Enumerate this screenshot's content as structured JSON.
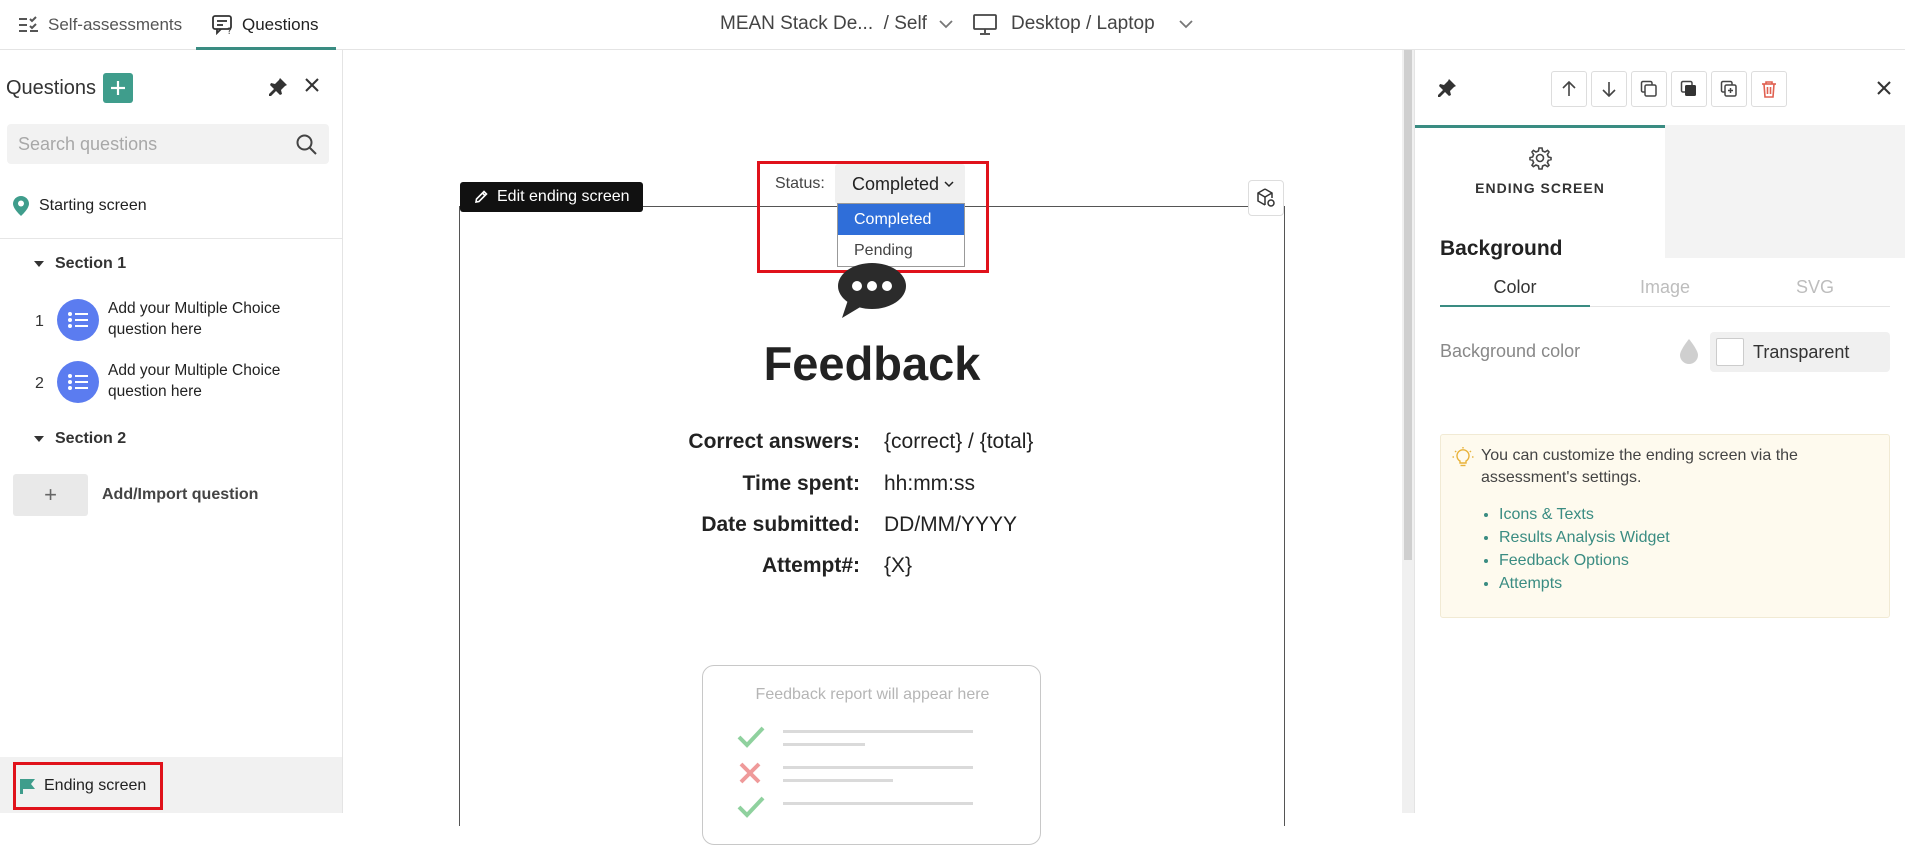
{
  "topbar": {
    "tabs": [
      {
        "label": "Self-assessments",
        "icon": "checklist-icon",
        "active": false
      },
      {
        "label": "Questions",
        "icon": "questions-icon",
        "active": true
      }
    ],
    "assessment_selector": "MEAN Stack De...  / Self",
    "device_selector": "Desktop / Laptop"
  },
  "sidebar": {
    "title": "Questions",
    "search_placeholder": "Search questions",
    "starting_screen": "Starting screen",
    "sections": [
      {
        "label": "Section 1",
        "questions": [
          {
            "num": "1",
            "text": "Add your Multiple Choice question here"
          },
          {
            "num": "2",
            "text": "Add your Multiple Choice question here"
          }
        ]
      },
      {
        "label": "Section 2",
        "questions": []
      }
    ],
    "add_import": "Add/Import question",
    "add_plus": "+",
    "ending_screen": "Ending screen"
  },
  "canvas": {
    "edit_button": "Edit ending screen",
    "status_label": "Status:",
    "status_value": "Completed",
    "status_options": [
      "Completed",
      "Pending"
    ],
    "title": "Feedback",
    "rows": [
      {
        "key": "Correct answers:",
        "value": "{correct} / {total}"
      },
      {
        "key": "Time spent:",
        "value": "hh:mm:ss"
      },
      {
        "key": "Date submitted:",
        "value": "DD/MM/YYYY"
      },
      {
        "key": "Attempt#:",
        "value": "{X}"
      }
    ],
    "report_caption": "Feedback report will appear here"
  },
  "right_panel": {
    "tab_label": "ENDING SCREEN",
    "background_heading": "Background",
    "bg_tabs": [
      "Color",
      "Image",
      "SVG"
    ],
    "bg_color_label": "Background color",
    "bg_color_value": "Transparent",
    "tip_text": "You can customize the ending screen via the assessment's settings.",
    "tip_links": [
      "Icons & Texts",
      "Results Analysis Widget",
      "Feedback Options",
      "Attempts"
    ]
  },
  "colors": {
    "accent": "#3a8c82",
    "question_icon": "#5b7cf0",
    "highlight": "#e0121b",
    "dropdown_selected": "#2f6ed9"
  }
}
